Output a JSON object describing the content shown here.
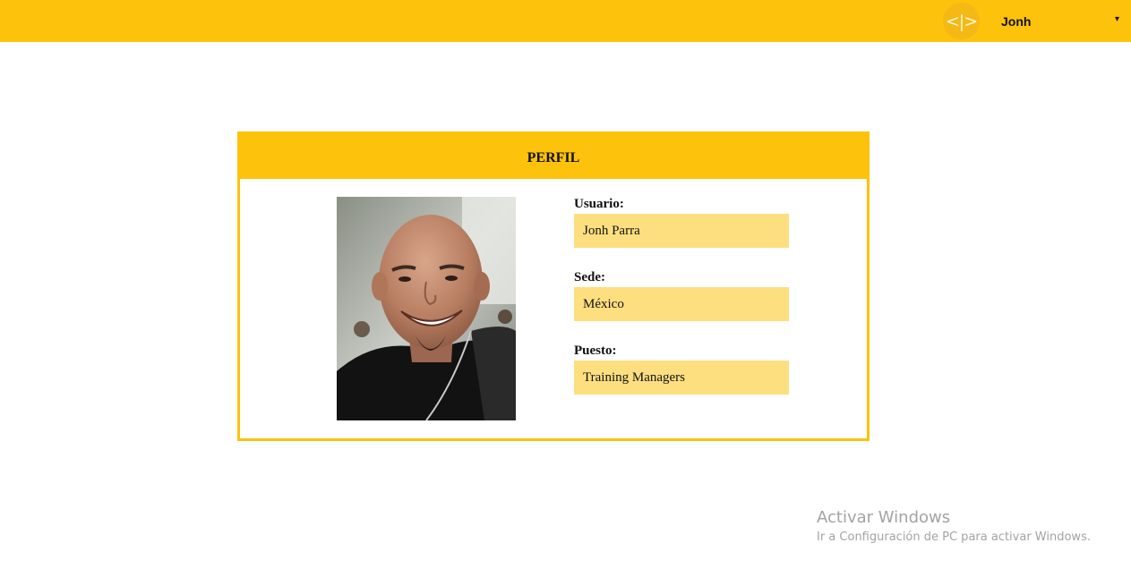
{
  "header": {
    "logo_glyph": "<|>",
    "user_name": "Jonh",
    "menu_caret": "▾",
    "bar_color": "#fdc20b"
  },
  "profile": {
    "title": "PERFIL",
    "photo": "profile-photo",
    "fields": [
      {
        "label": "Usuario:",
        "value": "Jonh Parra"
      },
      {
        "label": "Sede:",
        "value": "México"
      },
      {
        "label": "Puesto:",
        "value": "Training Managers"
      }
    ],
    "field_color": "#fddf80"
  },
  "watermark": {
    "title": "Activar Windows",
    "subtitle": "Ir a Configuración de PC para activar Windows."
  }
}
